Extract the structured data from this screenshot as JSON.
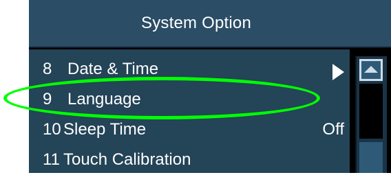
{
  "title": "System Option",
  "menu": {
    "items": [
      {
        "num": "8",
        "label": "Date & Time",
        "value": "",
        "has_submenu": true
      },
      {
        "num": "9",
        "label": "Language",
        "value": "",
        "has_submenu": false
      },
      {
        "num": "10",
        "label": "Sleep Time",
        "value": "Off",
        "has_submenu": false
      },
      {
        "num": "11",
        "label": "Touch Calibration",
        "value": "",
        "has_submenu": false
      }
    ]
  },
  "scrollbar": {
    "up_icon": "chevron-up-icon"
  },
  "annotation": {
    "color": "#00ff00"
  },
  "colors": {
    "title_bg": "#2b4d66",
    "menu_bg": "#244457",
    "text": "#ffffff"
  }
}
